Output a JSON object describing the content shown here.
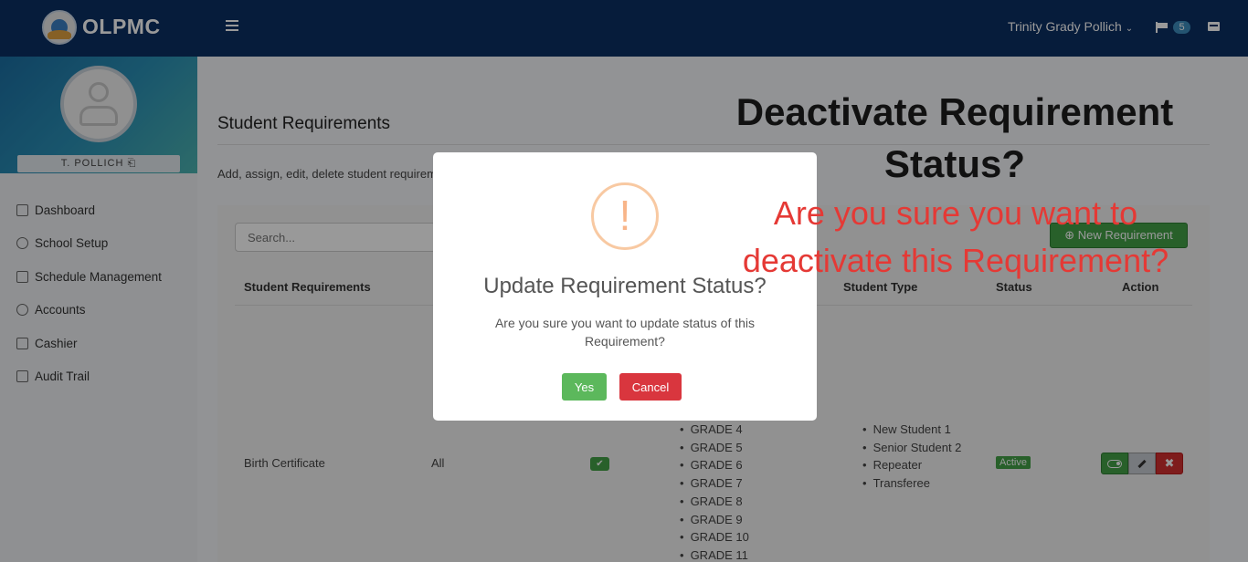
{
  "app": {
    "brand": "OLPMC"
  },
  "header": {
    "user_name": "Trinity Grady Pollich",
    "notification_count": "5"
  },
  "sidebar": {
    "profile_name": "T. POLLICH",
    "items": [
      {
        "label": "Dashboard",
        "icon": "home-icon"
      },
      {
        "label": "School Setup",
        "icon": "gear-icon"
      },
      {
        "label": "Schedule Management",
        "icon": "calendar-icon"
      },
      {
        "label": "Accounts",
        "icon": "users-icon"
      },
      {
        "label": "Cashier",
        "icon": "calculator-icon"
      },
      {
        "label": "Audit Trail",
        "icon": "book-icon"
      }
    ]
  },
  "main": {
    "title": "Student Requirements",
    "subtitle": "Add, assign, edit, delete student requirements",
    "search_placeholder": "Search...",
    "new_button": "New Requirement",
    "columns": {
      "requirement": "Student Requirements",
      "student_type": "Student Type",
      "status": "Status",
      "action": "Action"
    },
    "row": {
      "requirement": "Birth Certificate",
      "scope": "All",
      "grades": [
        "GRADE 4",
        "GRADE 5",
        "GRADE 6",
        "GRADE 7",
        "GRADE 8",
        "GRADE 9",
        "GRADE 10",
        "GRADE 11"
      ],
      "student_types": [
        "New Student 1",
        "Senior Student 2",
        "Repeater",
        "Transferee"
      ],
      "status": "Active"
    }
  },
  "modal": {
    "icon": "!",
    "title": "Update Requirement Status?",
    "text": "Are you sure you want to update status of this Requirement?",
    "yes_label": "Yes",
    "cancel_label": "Cancel"
  },
  "annotation": {
    "title": "Deactivate Requirement Status?",
    "question": "Are you sure you want to deactivate this Requirement?"
  },
  "colors": {
    "header": "#0b2f63",
    "success": "#43a047",
    "danger": "#d32f2f",
    "annotation_red": "#e53935"
  }
}
